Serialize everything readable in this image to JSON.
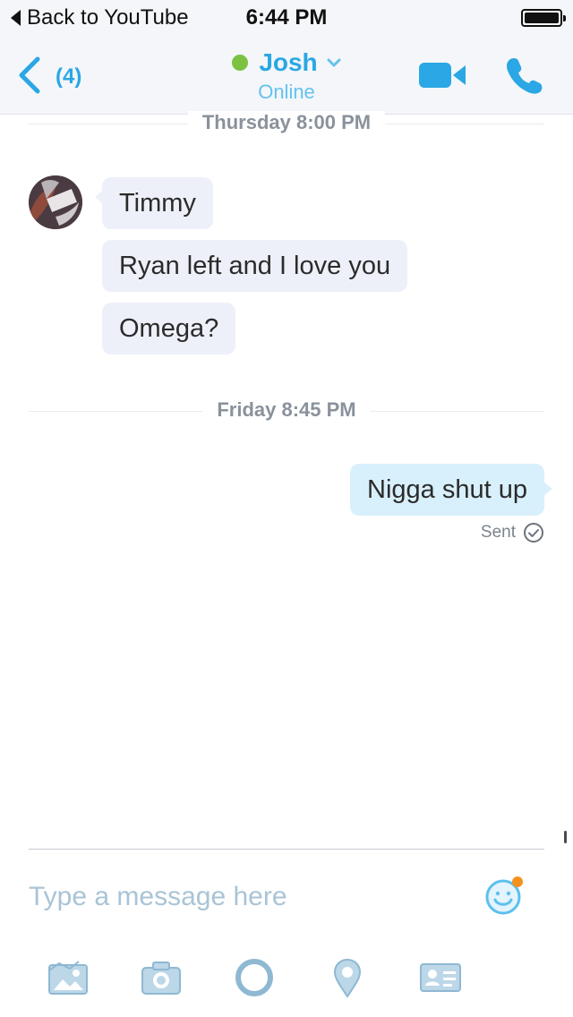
{
  "status_bar": {
    "back_app": "Back to YouTube",
    "time": "6:44 PM"
  },
  "header": {
    "unread_count": "(4)",
    "contact_name": "Josh",
    "contact_status": "Online",
    "presence_color": "#7cc242",
    "accent_color": "#2aa7e4"
  },
  "conversation": {
    "separators": [
      {
        "label": "Thursday 8:00 PM"
      },
      {
        "label": "Friday 8:45 PM"
      }
    ],
    "incoming": [
      {
        "text": "Timmy"
      },
      {
        "text": "Ryan left and I love you"
      },
      {
        "text": "Omega?"
      }
    ],
    "outgoing": [
      {
        "text": "Nigga shut up",
        "status": "Sent"
      }
    ]
  },
  "composer": {
    "placeholder": "Type a message here",
    "emoji_icon": "smiley-icon"
  },
  "toolbar": {
    "icons": [
      "gallery-icon",
      "camera-icon",
      "video-message-icon",
      "location-icon",
      "contact-card-icon"
    ]
  }
}
